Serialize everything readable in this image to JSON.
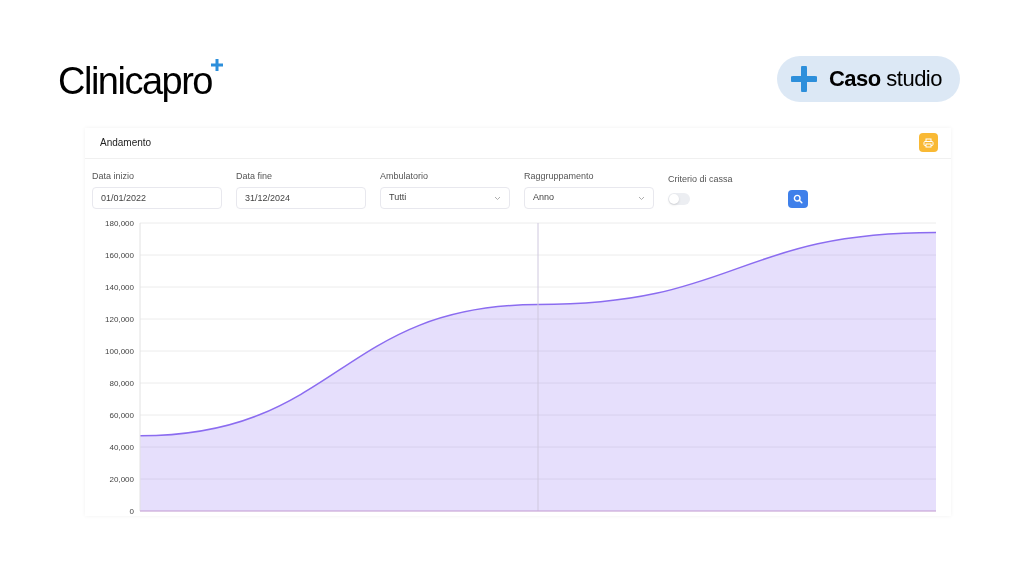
{
  "brand": {
    "logo": "Clinicapro",
    "badge": "**Caso** studio"
  },
  "panel": {
    "title": "Andamento",
    "filters": [
      {
        "kind": "input",
        "label": "Data inizio",
        "value": "01/01/2022"
      },
      {
        "kind": "input",
        "label": "Data fine",
        "value": "31/12/2024"
      },
      {
        "kind": "select",
        "label": "Ambulatorio",
        "value": "Tutti"
      },
      {
        "kind": "select",
        "label": "Raggruppamento",
        "value": "Anno"
      },
      {
        "kind": "toggle",
        "label": "Criterio di cassa",
        "on": false
      }
    ],
    "chart_data": {
      "type": "area",
      "grid": true,
      "series": [
        {
          "color": "#8b6cf0",
          "values": [
            47000,
            129000,
            174000
          ]
        }
      ],
      "ylim": [
        0,
        180000
      ],
      "yticks": [
        {
          "value": 0,
          "label": "0"
        },
        {
          "value": 20000,
          "label": "20,000"
        },
        {
          "value": 40000,
          "label": "40,000"
        },
        {
          "value": 60000,
          "label": "60,000"
        },
        {
          "value": 80000,
          "label": "80,000"
        },
        {
          "value": 100000,
          "label": "100,000"
        },
        {
          "value": 120000,
          "label": "120,000"
        },
        {
          "value": 140000,
          "label": "140,000"
        },
        {
          "value": 160000,
          "label": "160,000"
        },
        {
          "value": 180000,
          "label": "180,000"
        }
      ]
    }
  }
}
